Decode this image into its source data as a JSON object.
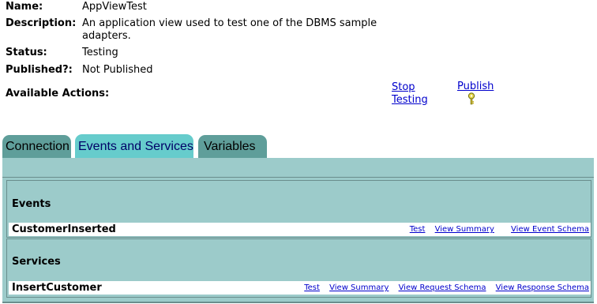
{
  "details": {
    "name_label": "Name:",
    "name_value": "AppViewTest",
    "description_label": "Description:",
    "description_line1": "An application view used to test one of the DBMS sample",
    "description_line2": "adapters.",
    "status_label": "Status:",
    "status_value": "Testing",
    "published_label": "Published?:",
    "published_value": "Not Published",
    "actions_label": "Available Actions:"
  },
  "actions": {
    "stop_testing_line1": "Stop",
    "stop_testing_line2": "Testing",
    "publish": "Publish",
    "publish_icon": "key-icon"
  },
  "tabs": [
    {
      "label": "Connection",
      "selected": false
    },
    {
      "label": "Events and Services",
      "selected": true
    },
    {
      "label": "Variables",
      "selected": false
    }
  ],
  "events": {
    "title": "Events",
    "rows": [
      {
        "name": "CustomerInserted",
        "links": [
          "Test",
          "View Summary",
          "View Event Schema"
        ]
      }
    ]
  },
  "services": {
    "title": "Services",
    "rows": [
      {
        "name": "InsertCustomer",
        "links": [
          "Test",
          "View Summary",
          "View Request Schema",
          "View Response Schema"
        ]
      }
    ]
  },
  "colors": {
    "tab_active": "#66cccc",
    "tab_inactive": "#5f9e9a",
    "panel": "#9ccbca",
    "link": "#0000cc"
  }
}
